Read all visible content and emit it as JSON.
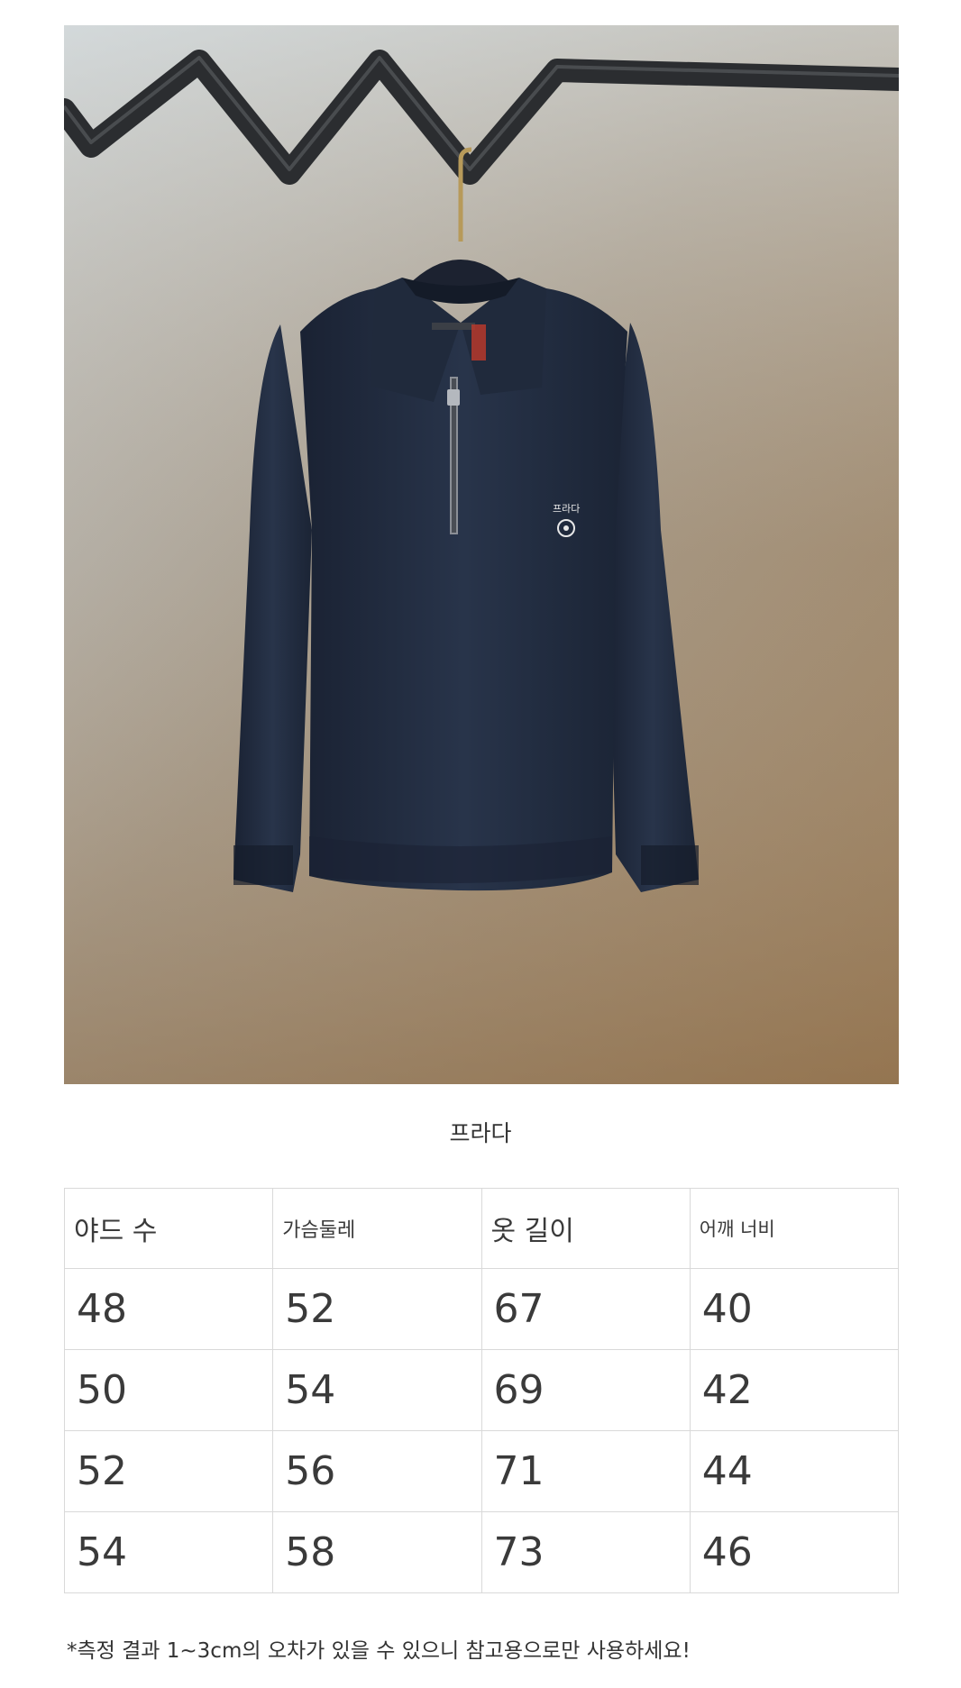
{
  "product": {
    "brand_label": "프라다",
    "embroidery_text": "프라다"
  },
  "size_table": {
    "headers": [
      "야드 수",
      "가슴둘레",
      "옷 길이",
      "어깨 너비"
    ],
    "rows": [
      [
        "48",
        "52",
        "67",
        "40"
      ],
      [
        "50",
        "54",
        "69",
        "42"
      ],
      [
        "52",
        "56",
        "71",
        "44"
      ],
      [
        "54",
        "58",
        "73",
        "46"
      ]
    ]
  },
  "note": "*측정 결과 1~3cm의 오차가 있을 수 있으니 참고용으로만 사용하세요!",
  "colors": {
    "sweater_navy": "#1f2a3c",
    "rack_dark": "#2b2d30",
    "border": "#d9d9d9",
    "text": "#333333"
  }
}
